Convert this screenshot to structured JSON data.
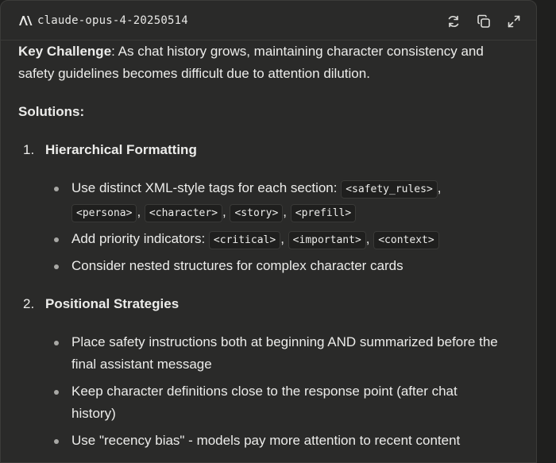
{
  "header": {
    "model_name": "claude-opus-4-20250514",
    "buttons": [
      "refresh-icon",
      "copy-icon",
      "expand-icon"
    ]
  },
  "content": {
    "key_challenge_label": "Key Challenge",
    "key_challenge_text_1": ": As chat history grows, maintaining character consistency and",
    "key_challenge_text_2": "safety guidelines becomes difficult due to attention dilution.",
    "solutions_heading": "Solutions:",
    "section1": {
      "number": "1.",
      "title": "Hierarchical Formatting",
      "bullet1_text": "Use distinct XML-style tags for each section:",
      "bullet1_tags": [
        "<safety_rules>",
        "<persona>",
        "<character>",
        "<story>",
        "<prefill>"
      ],
      "bullet2_text": "Add priority indicators:",
      "bullet2_tags": [
        "<critical>",
        "<important>",
        "<context>"
      ],
      "bullet3_text": "Consider nested structures for complex character cards"
    },
    "section2": {
      "number": "2.",
      "title": "Positional Strategies",
      "bullet1_line1": "Place safety instructions both at beginning AND summarized before the",
      "bullet1_line2": "final assistant message",
      "bullet2_line1": "Keep character definitions close to the response point (after chat",
      "bullet2_line2": "history)",
      "bullet3_text": "Use \"recency bias\" - models pay more attention to recent content"
    },
    "separator": ","
  }
}
